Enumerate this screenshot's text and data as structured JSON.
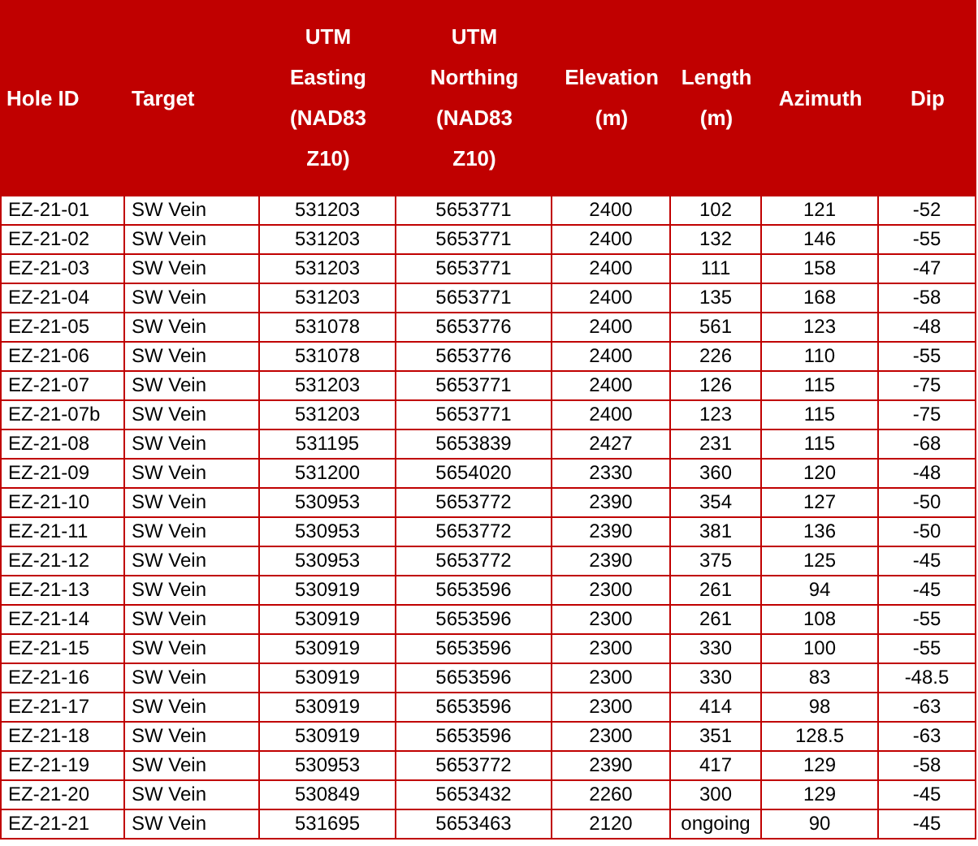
{
  "table": {
    "columns": [
      {
        "lines": [
          "Hole ID"
        ],
        "kind": "text"
      },
      {
        "lines": [
          "Target"
        ],
        "kind": "text"
      },
      {
        "lines": [
          "UTM",
          "Easting",
          "(NAD83",
          "Z10)"
        ],
        "kind": "number"
      },
      {
        "lines": [
          "UTM",
          "Northing",
          "(NAD83",
          "Z10)"
        ],
        "kind": "number"
      },
      {
        "lines": [
          "Elevation",
          "(m)"
        ],
        "kind": "number"
      },
      {
        "lines": [
          "Length",
          "(m)"
        ],
        "kind": "number"
      },
      {
        "lines": [
          "Azimuth"
        ],
        "kind": "number"
      },
      {
        "lines": [
          "Dip"
        ],
        "kind": "number"
      }
    ],
    "rows": [
      [
        "EZ-21-01",
        "SW Vein",
        "531203",
        "5653771",
        "2400",
        "102",
        "121",
        "-52"
      ],
      [
        "EZ-21-02",
        "SW Vein",
        "531203",
        "5653771",
        "2400",
        "132",
        "146",
        "-55"
      ],
      [
        "EZ-21-03",
        "SW Vein",
        "531203",
        "5653771",
        "2400",
        "111",
        "158",
        "-47"
      ],
      [
        "EZ-21-04",
        "SW Vein",
        "531203",
        "5653771",
        "2400",
        "135",
        "168",
        "-58"
      ],
      [
        "EZ-21-05",
        "SW Vein",
        "531078",
        "5653776",
        "2400",
        "561",
        "123",
        "-48"
      ],
      [
        "EZ-21-06",
        "SW Vein",
        "531078",
        "5653776",
        "2400",
        "226",
        "110",
        "-55"
      ],
      [
        "EZ-21-07",
        "SW Vein",
        "531203",
        "5653771",
        "2400",
        "126",
        "115",
        "-75"
      ],
      [
        "EZ-21-07b",
        "SW Vein",
        "531203",
        "5653771",
        "2400",
        "123",
        "115",
        "-75"
      ],
      [
        "EZ-21-08",
        "SW Vein",
        "531195",
        "5653839",
        "2427",
        "231",
        "115",
        "-68"
      ],
      [
        "EZ-21-09",
        "SW Vein",
        "531200",
        "5654020",
        "2330",
        "360",
        "120",
        "-48"
      ],
      [
        "EZ-21-10",
        "SW Vein",
        "530953",
        "5653772",
        "2390",
        "354",
        "127",
        "-50"
      ],
      [
        "EZ-21-11",
        "SW Vein",
        "530953",
        "5653772",
        "2390",
        "381",
        "136",
        "-50"
      ],
      [
        "EZ-21-12",
        "SW Vein",
        "530953",
        "5653772",
        "2390",
        "375",
        "125",
        "-45"
      ],
      [
        "EZ-21-13",
        "SW Vein",
        "530919",
        "5653596",
        "2300",
        "261",
        "94",
        "-45"
      ],
      [
        "EZ-21-14",
        "SW Vein",
        "530919",
        "5653596",
        "2300",
        "261",
        "108",
        "-55"
      ],
      [
        "EZ-21-15",
        "SW Vein",
        "530919",
        "5653596",
        "2300",
        "330",
        "100",
        "-55"
      ],
      [
        "EZ-21-16",
        "SW Vein",
        "530919",
        "5653596",
        "2300",
        "330",
        "83",
        "-48.5"
      ],
      [
        "EZ-21-17",
        "SW Vein",
        "530919",
        "5653596",
        "2300",
        "414",
        "98",
        "-63"
      ],
      [
        "EZ-21-18",
        "SW Vein",
        "530919",
        "5653596",
        "2300",
        "351",
        "128.5",
        "-63"
      ],
      [
        "EZ-21-19",
        "SW Vein",
        "530953",
        "5653772",
        "2390",
        "417",
        "129",
        "-58"
      ],
      [
        "EZ-21-20",
        "SW Vein",
        "530849",
        "5653432",
        "2260",
        "300",
        "129",
        "-45"
      ],
      [
        "EZ-21-21",
        "SW Vein",
        "531695",
        "5653463",
        "2120",
        "ongoing",
        "90",
        "-45"
      ]
    ]
  }
}
